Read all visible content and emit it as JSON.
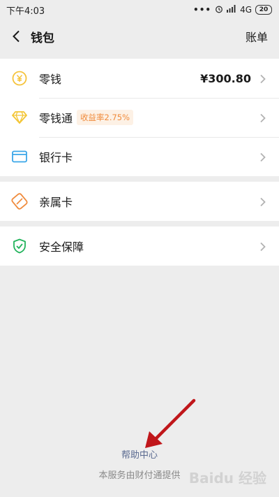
{
  "status_bar": {
    "time": "下午4:03",
    "dots": "•••",
    "network": "4G",
    "battery": "20"
  },
  "header": {
    "title": "钱包",
    "bill_label": "账单"
  },
  "wallet_items": [
    {
      "label": "零钱",
      "value": "¥300.80",
      "icon": "yuan-coin-icon"
    },
    {
      "label": "零钱通",
      "badge": "收益率2.75%",
      "icon": "diamond-icon"
    },
    {
      "label": "银行卡",
      "icon": "bank-card-icon"
    }
  ],
  "family_items": [
    {
      "label": "亲属卡",
      "icon": "family-card-icon"
    }
  ],
  "security_items": [
    {
      "label": "安全保障",
      "icon": "shield-check-icon"
    }
  ],
  "footer": {
    "help_link": "帮助中心",
    "service_note": "本服务由财付通提供"
  },
  "watermark": "Baidu 经验",
  "colors": {
    "yuan": "#f5c33b",
    "diamond": "#f3c534",
    "card": "#3aa6e8",
    "family": "#f08b3c",
    "shield": "#22b35c",
    "arrow": "#c0161a"
  }
}
